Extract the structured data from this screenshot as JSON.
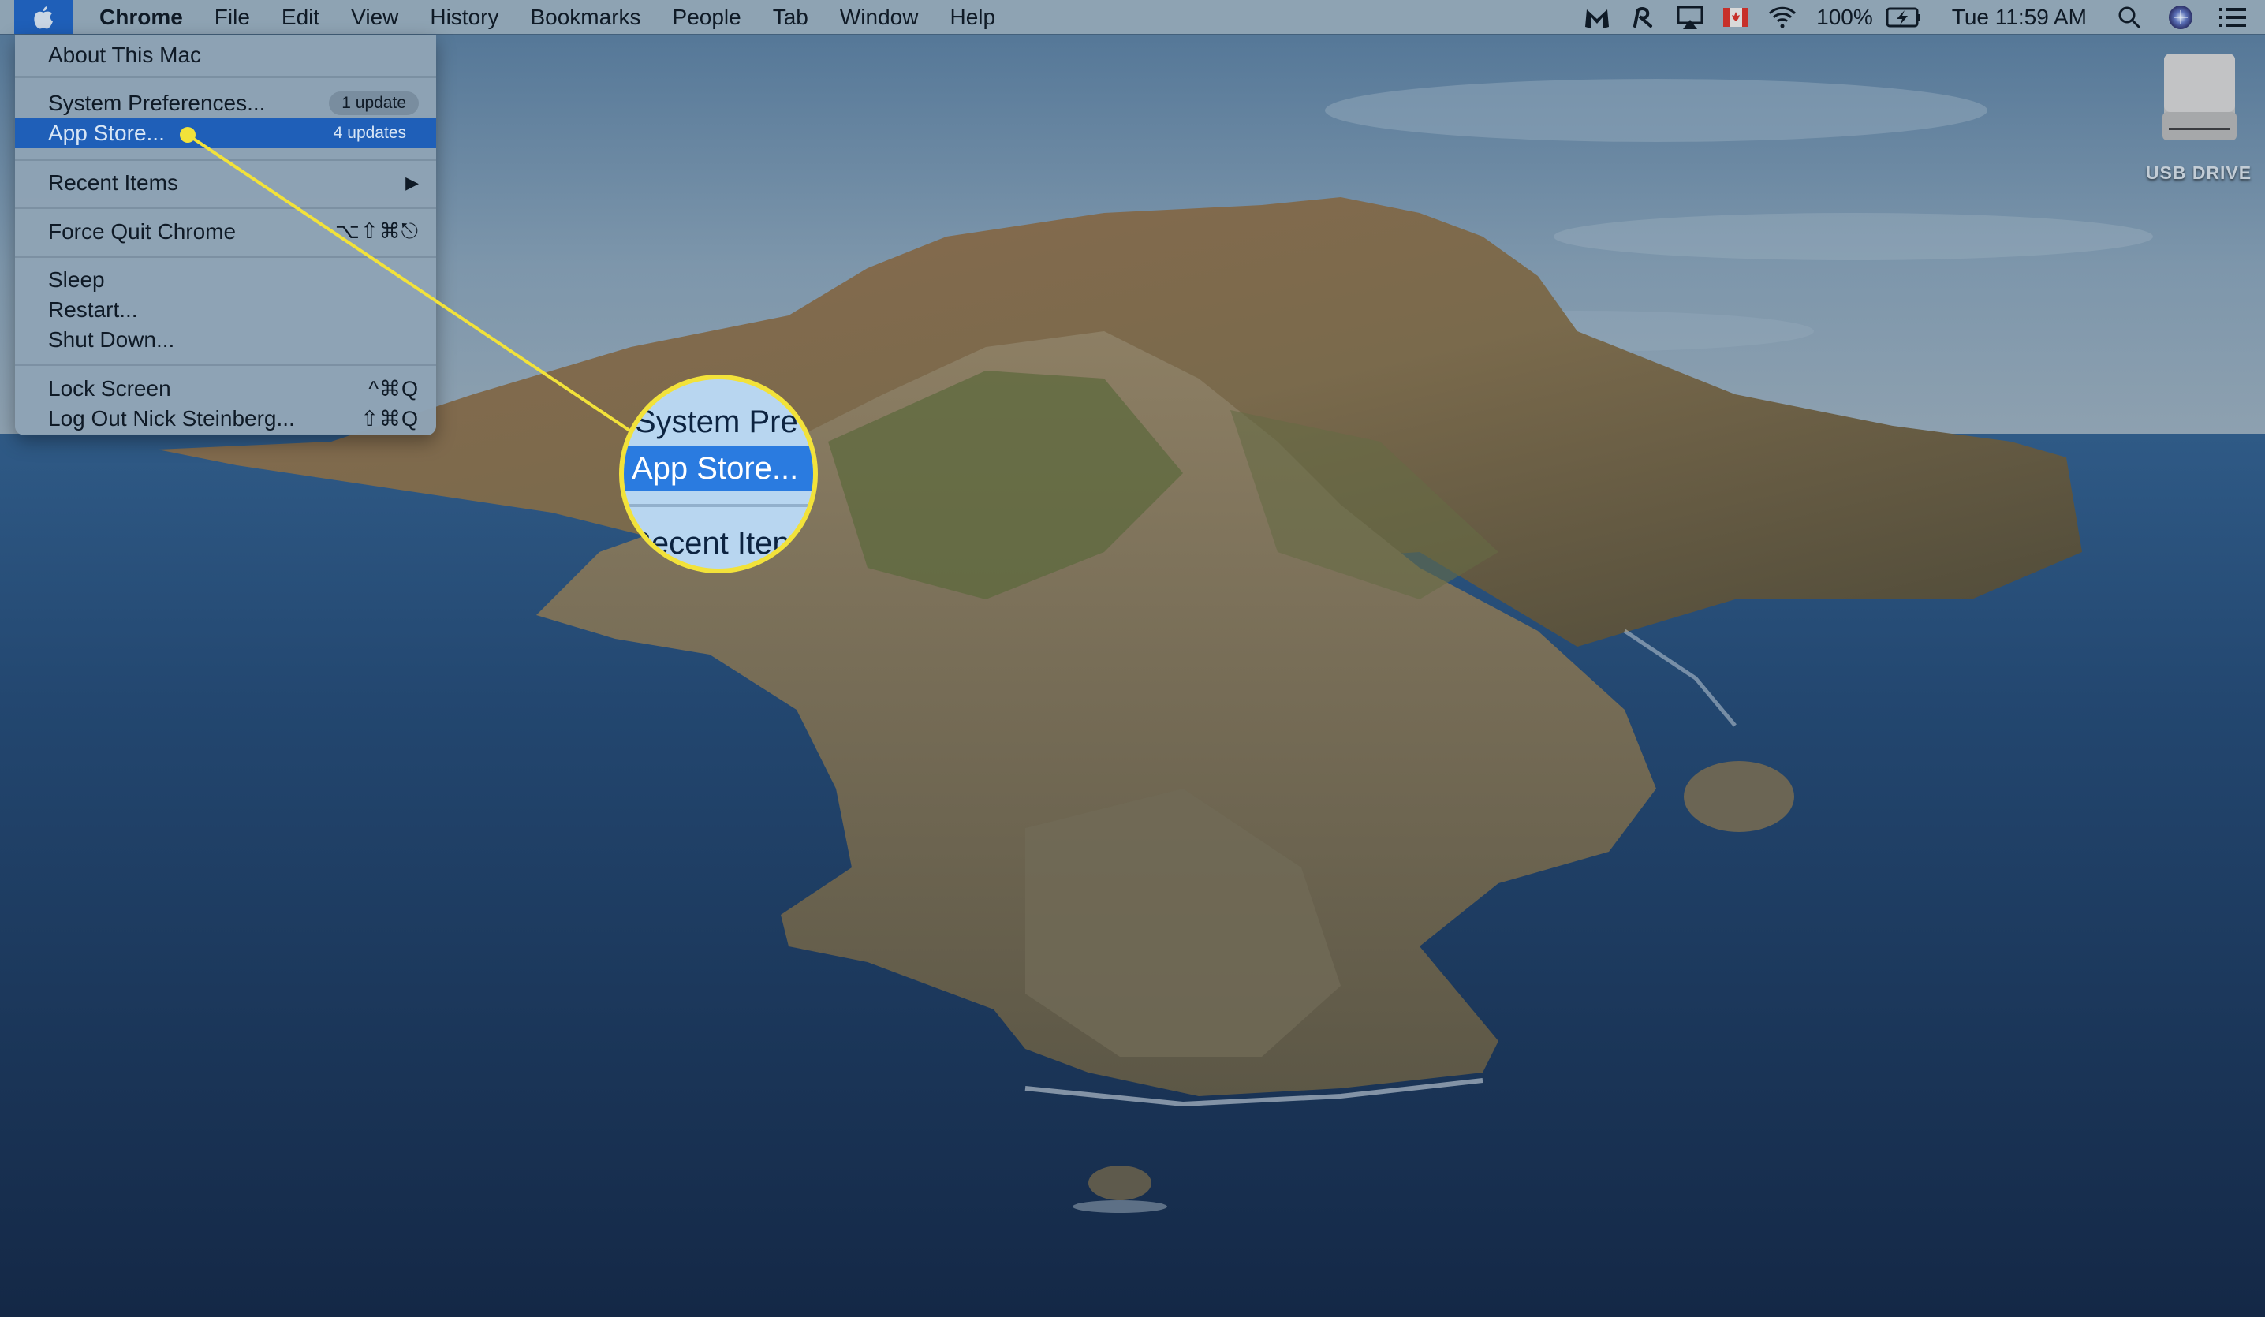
{
  "menubar": {
    "apple_icon": "apple-logo-icon",
    "app_name": "Chrome",
    "menus": [
      "File",
      "Edit",
      "View",
      "History",
      "Bookmarks",
      "People",
      "Tab",
      "Window",
      "Help"
    ],
    "status": {
      "icons": [
        "malwarebytes-icon",
        "creative-cloud-icon",
        "airplay-icon",
        "canada-flag-icon",
        "wifi-icon"
      ],
      "battery_percent": "100%",
      "battery_icon": "battery-charging-icon",
      "clock": "Tue 11:59 AM",
      "trailing_icons": [
        "spotlight-search-icon",
        "siri-icon",
        "notification-center-icon"
      ]
    }
  },
  "apple_menu": {
    "items": [
      {
        "label": "About This Mac"
      },
      {
        "label": "System Preferences...",
        "badge": "1 update"
      },
      {
        "label": "App Store...",
        "badge": "4 updates",
        "highlighted": true
      },
      {
        "label": "Recent Items",
        "submenu": "▶"
      },
      {
        "label": "Force Quit Chrome",
        "shortcut": "⌥⇧⌘⎋"
      },
      {
        "label": "Sleep"
      },
      {
        "label": "Restart..."
      },
      {
        "label": "Shut Down..."
      },
      {
        "label": "Lock Screen",
        "shortcut": "^⌘Q"
      },
      {
        "label": "Log Out Nick Steinberg...",
        "shortcut": "⇧⌘Q"
      }
    ]
  },
  "callout": {
    "rows": [
      "System Pre",
      "App Store...",
      "Recent Iten"
    ],
    "color": "#f2e23a"
  },
  "desktop": {
    "icons": [
      {
        "label": "USB DRIVE",
        "icon": "external-drive-icon"
      }
    ]
  },
  "colors": {
    "highlight": "#1f5fb8",
    "menubar": "#8ea3b3",
    "callout_yellow": "#f2e23a"
  }
}
